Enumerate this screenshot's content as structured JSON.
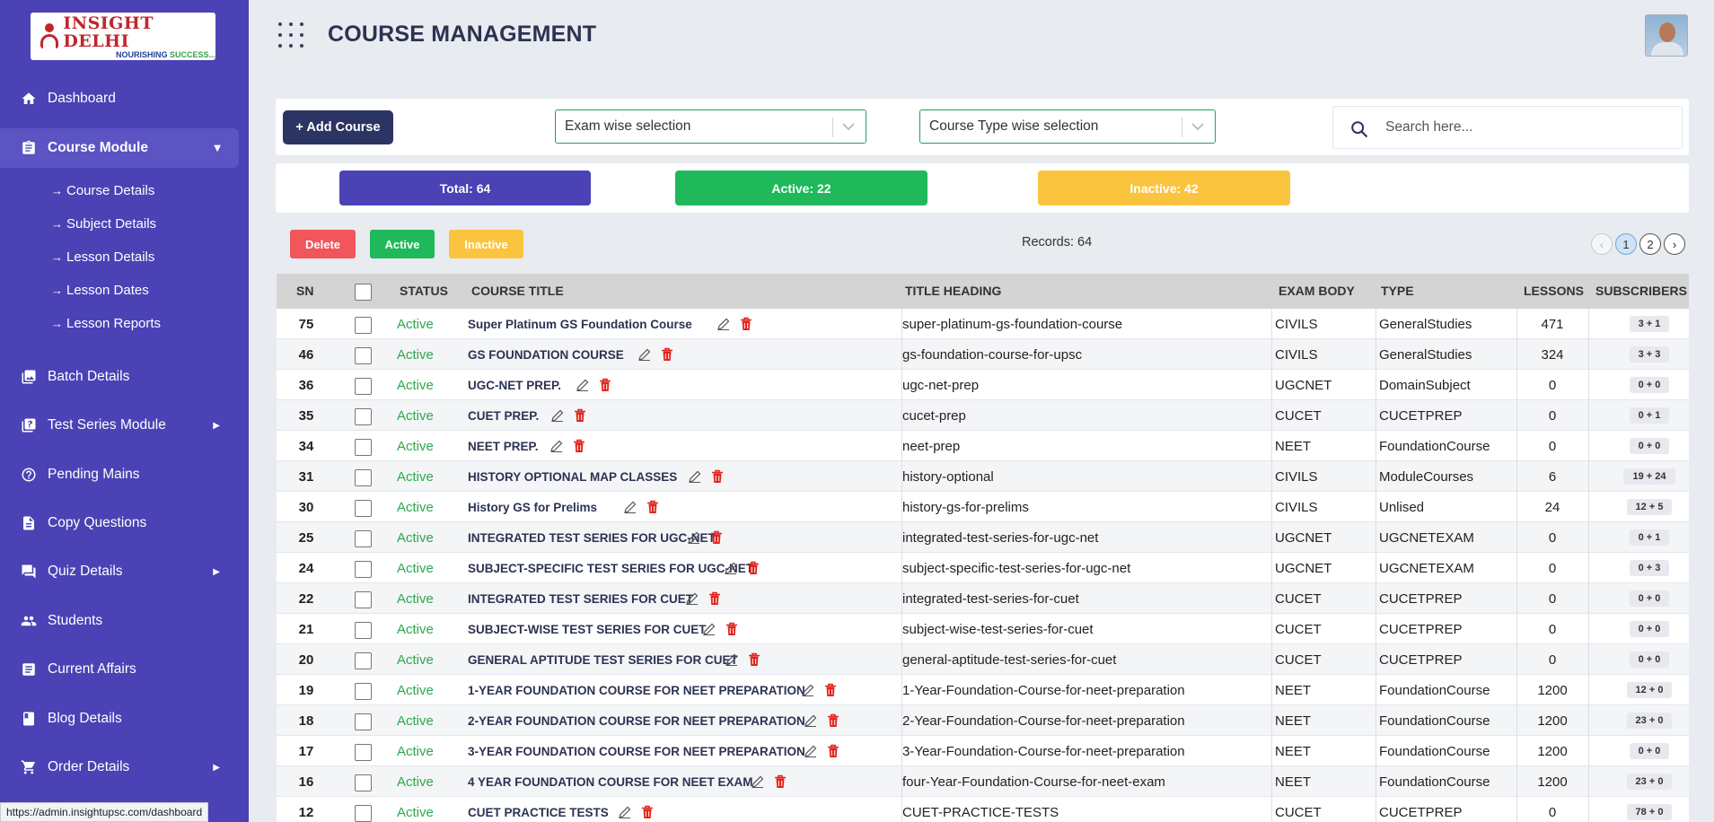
{
  "brand": {
    "name": "INSIGHT DELHI",
    "tagline_a": "NOURISHING ",
    "tagline_b": "SUCCESS..."
  },
  "header": {
    "title": "COURSE MANAGEMENT"
  },
  "sidebar": {
    "items": [
      {
        "label": "Dashboard",
        "icon": "home-icon"
      },
      {
        "label": "Course Module",
        "icon": "clipboard-icon"
      },
      {
        "label": "Batch Details",
        "icon": "images-icon"
      },
      {
        "label": "Test Series Module",
        "icon": "quiz-icon"
      },
      {
        "label": "Pending Mains",
        "icon": "help-circle-icon"
      },
      {
        "label": "Copy Questions",
        "icon": "document-icon"
      },
      {
        "label": "Quiz Details",
        "icon": "forum-icon"
      },
      {
        "label": "Students",
        "icon": "people-icon"
      },
      {
        "label": "Current Affairs",
        "icon": "article-icon"
      },
      {
        "label": "Blog Details",
        "icon": "book-icon"
      },
      {
        "label": "Order Details",
        "icon": "cart-icon"
      }
    ],
    "course_sub": [
      "Course Details",
      "Subject Details",
      "Lesson Details",
      "Lesson Dates",
      "Lesson Reports"
    ]
  },
  "toolbar": {
    "add_label": "+ Add Course",
    "exam_select": "Exam wise selection",
    "type_select": "Course Type wise selection",
    "search_placeholder": "Search here..."
  },
  "stats": {
    "total": "Total: 64",
    "active": "Active: 22",
    "inactive": "Inactive: 42"
  },
  "actions": {
    "delete": "Delete",
    "active": "Active",
    "inactive": "Inactive",
    "records": "Records: 64"
  },
  "pagination": {
    "pages": [
      "1",
      "2"
    ],
    "current": "1",
    "prev": "‹",
    "next": "›"
  },
  "table": {
    "headers": [
      "SN",
      "STATUS",
      "COURSE TITLE",
      "TITLE HEADING",
      "EXAM BODY",
      "TYPE",
      "LESSONS",
      "SUBSCRIBERS"
    ],
    "rows": [
      {
        "sn": "75",
        "status": "Active",
        "title": "Super Platinum GS Foundation Course",
        "heading": "super-platinum-gs-foundation-course",
        "exam": "CIVILS",
        "type": "GeneralStudies",
        "lessons": "471",
        "subs": "3 + 1"
      },
      {
        "sn": "46",
        "status": "Active",
        "title": "GS FOUNDATION COURSE",
        "heading": "gs-foundation-course-for-upsc",
        "exam": "CIVILS",
        "type": "GeneralStudies",
        "lessons": "324",
        "subs": "3 + 3"
      },
      {
        "sn": "36",
        "status": "Active",
        "title": "UGC-NET PREP.",
        "heading": "ugc-net-prep",
        "exam": "UGCNET",
        "type": "DomainSubject",
        "lessons": "0",
        "subs": "0 + 0"
      },
      {
        "sn": "35",
        "status": "Active",
        "title": "CUET PREP.",
        "heading": "cucet-prep",
        "exam": "CUCET",
        "type": "CUCETPREP",
        "lessons": "0",
        "subs": "0 + 1"
      },
      {
        "sn": "34",
        "status": "Active",
        "title": "NEET PREP.",
        "heading": "neet-prep",
        "exam": "NEET",
        "type": "FoundationCourse",
        "lessons": "0",
        "subs": "0 + 0"
      },
      {
        "sn": "31",
        "status": "Active",
        "title": "HISTORY OPTIONAL MAP CLASSES",
        "heading": "history-optional",
        "exam": "CIVILS",
        "type": "ModuleCourses",
        "lessons": "6",
        "subs": "19 + 24"
      },
      {
        "sn": "30",
        "status": "Active",
        "title": "History GS for Prelims",
        "heading": "history-gs-for-prelims",
        "exam": "CIVILS",
        "type": "Unlised",
        "lessons": "24",
        "subs": "12 + 5"
      },
      {
        "sn": "25",
        "status": "Active",
        "title": "INTEGRATED TEST SERIES FOR UGC-NET",
        "heading": "integrated-test-series-for-ugc-net",
        "exam": "UGCNET",
        "type": "UGCNETEXAM",
        "lessons": "0",
        "subs": "0 + 1"
      },
      {
        "sn": "24",
        "status": "Active",
        "title": "SUBJECT-SPECIFIC TEST SERIES FOR UGC-NET",
        "heading": "subject-specific-test-series-for-ugc-net",
        "exam": "UGCNET",
        "type": "UGCNETEXAM",
        "lessons": "0",
        "subs": "0 + 3"
      },
      {
        "sn": "22",
        "status": "Active",
        "title": "INTEGRATED TEST SERIES FOR CUET",
        "heading": "integrated-test-series-for-cuet",
        "exam": "CUCET",
        "type": "CUCETPREP",
        "lessons": "0",
        "subs": "0 + 0"
      },
      {
        "sn": "21",
        "status": "Active",
        "title": "SUBJECT-WISE TEST SERIES FOR CUET",
        "heading": "subject-wise-test-series-for-cuet",
        "exam": "CUCET",
        "type": "CUCETPREP",
        "lessons": "0",
        "subs": "0 + 0"
      },
      {
        "sn": "20",
        "status": "Active",
        "title": "GENERAL APTITUDE TEST SERIES FOR CUET",
        "heading": "general-aptitude-test-series-for-cuet",
        "exam": "CUCET",
        "type": "CUCETPREP",
        "lessons": "0",
        "subs": "0 + 0"
      },
      {
        "sn": "19",
        "status": "Active",
        "title": "1-YEAR FOUNDATION COURSE FOR NEET PREPARATION",
        "heading": "1-Year-Foundation-Course-for-neet-preparation",
        "exam": "NEET",
        "type": "FoundationCourse",
        "lessons": "1200",
        "subs": "12 + 0"
      },
      {
        "sn": "18",
        "status": "Active",
        "title": "2-YEAR FOUNDATION COURSE FOR NEET PREPARATION",
        "heading": "2-Year-Foundation-Course-for-neet-preparation",
        "exam": "NEET",
        "type": "FoundationCourse",
        "lessons": "1200",
        "subs": "23 + 0"
      },
      {
        "sn": "17",
        "status": "Active",
        "title": "3-YEAR FOUNDATION COURSE FOR NEET PREPARATION",
        "heading": "3-Year-Foundation-Course-for-neet-preparation",
        "exam": "NEET",
        "type": "FoundationCourse",
        "lessons": "1200",
        "subs": "0 + 0"
      },
      {
        "sn": "16",
        "status": "Active",
        "title": "4 YEAR FOUNDATION COURSE FOR NEET EXAM",
        "heading": "four-Year-Foundation-Course-for-neet-exam",
        "exam": "NEET",
        "type": "FoundationCourse",
        "lessons": "1200",
        "subs": "23 + 0"
      },
      {
        "sn": "12",
        "status": "Active",
        "title": "CUET PRACTICE TESTS",
        "heading": "CUET-PRACTICE-TESTS",
        "exam": "CUCET",
        "type": "CUCETPREP",
        "lessons": "0",
        "subs": "78 + 0"
      }
    ]
  },
  "status_bar": {
    "url": "https://admin.insightupsc.com/dashboard"
  },
  "colors": {
    "sidebar": "#4b42b5",
    "total": "#4b42b5",
    "active": "#1fb85a",
    "inactive": "#fbc43f",
    "delete": "#f0565a",
    "navy": "#2c3464"
  }
}
